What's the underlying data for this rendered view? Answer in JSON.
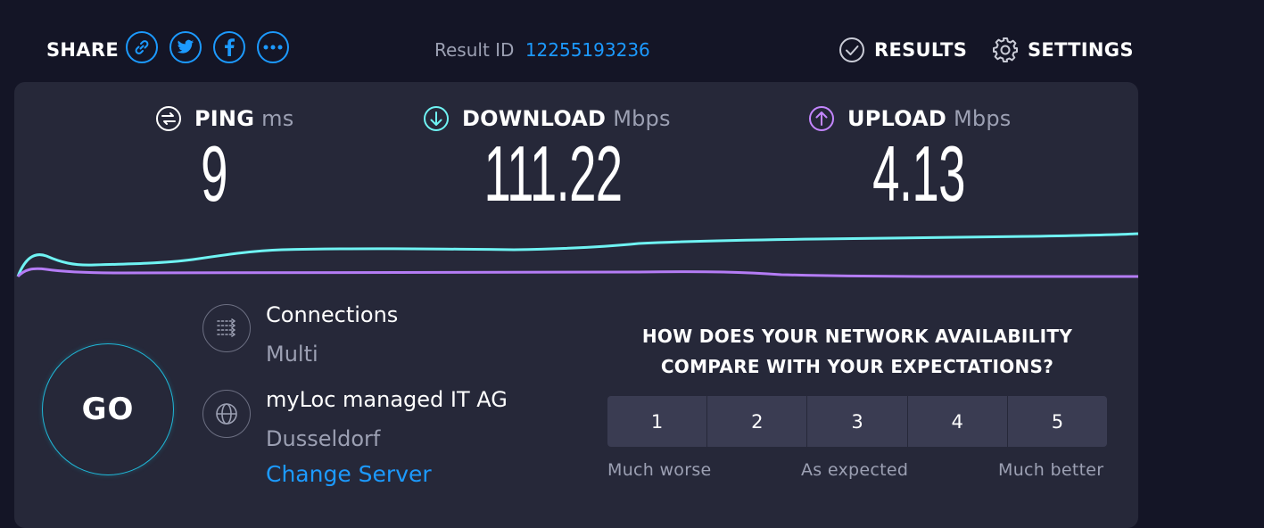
{
  "header": {
    "share_label": "SHARE",
    "share_buttons": [
      "link-icon",
      "twitter-icon",
      "facebook-icon",
      "more-icon"
    ],
    "result_id_label": "Result ID",
    "result_id_value": "12255193236",
    "results_label": "RESULTS",
    "settings_label": "SETTINGS"
  },
  "metrics": {
    "ping": {
      "label": "PING",
      "unit": "ms",
      "value": "9",
      "icon": "ping-icon",
      "color": "#ffffff"
    },
    "download": {
      "label": "DOWNLOAD",
      "unit": "Mbps",
      "value": "111.22",
      "icon": "download-arrow-icon",
      "color": "#6ff3f3"
    },
    "upload": {
      "label": "UPLOAD",
      "unit": "Mbps",
      "value": "4.13",
      "icon": "upload-arrow-icon",
      "color": "#c486ff"
    }
  },
  "go_button": {
    "label": "GO",
    "accent": "#1fb8d8"
  },
  "connections": {
    "title": "Connections",
    "value": "Multi",
    "icon": "connections-icon"
  },
  "server": {
    "name": "myLoc managed IT AG",
    "location": "Dusseldorf",
    "change_label": "Change Server",
    "icon": "globe-icon"
  },
  "survey": {
    "question_line1": "HOW DOES YOUR NETWORK AVAILABILITY",
    "question_line2": "COMPARE WITH YOUR EXPECTATIONS?",
    "options": [
      "1",
      "2",
      "3",
      "4",
      "5"
    ],
    "label_low": "Much worse",
    "label_mid": "As expected",
    "label_high": "Much better"
  },
  "colors": {
    "background": "#141526",
    "panel": "#262839",
    "accent_blue": "#1c9aff",
    "download_line": "#6ff3f3",
    "upload_line": "#b47cf5"
  }
}
